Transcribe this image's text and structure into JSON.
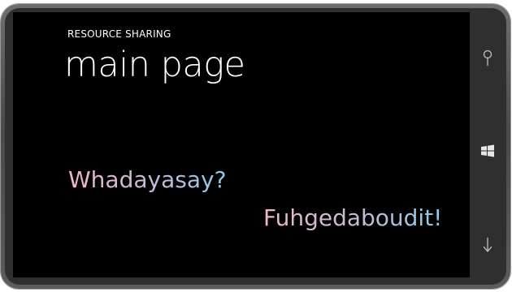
{
  "app": {
    "title": "RESOURCE SHARING",
    "page_title": "main page"
  },
  "content": {
    "text_1": "Whadayasay?",
    "text_2": "Fuhgedaboudit!"
  },
  "colors": {
    "screen_background": "#000000",
    "title_text": "#ffffff",
    "gradient_start": "#f1b7c7",
    "gradient_end": "#8fc8e6",
    "bezel": "#4a4a4a"
  },
  "hardware_buttons": [
    {
      "name": "search",
      "icon": "search-icon"
    },
    {
      "name": "start",
      "icon": "windows-logo-icon"
    },
    {
      "name": "back",
      "icon": "back-arrow-icon"
    }
  ]
}
